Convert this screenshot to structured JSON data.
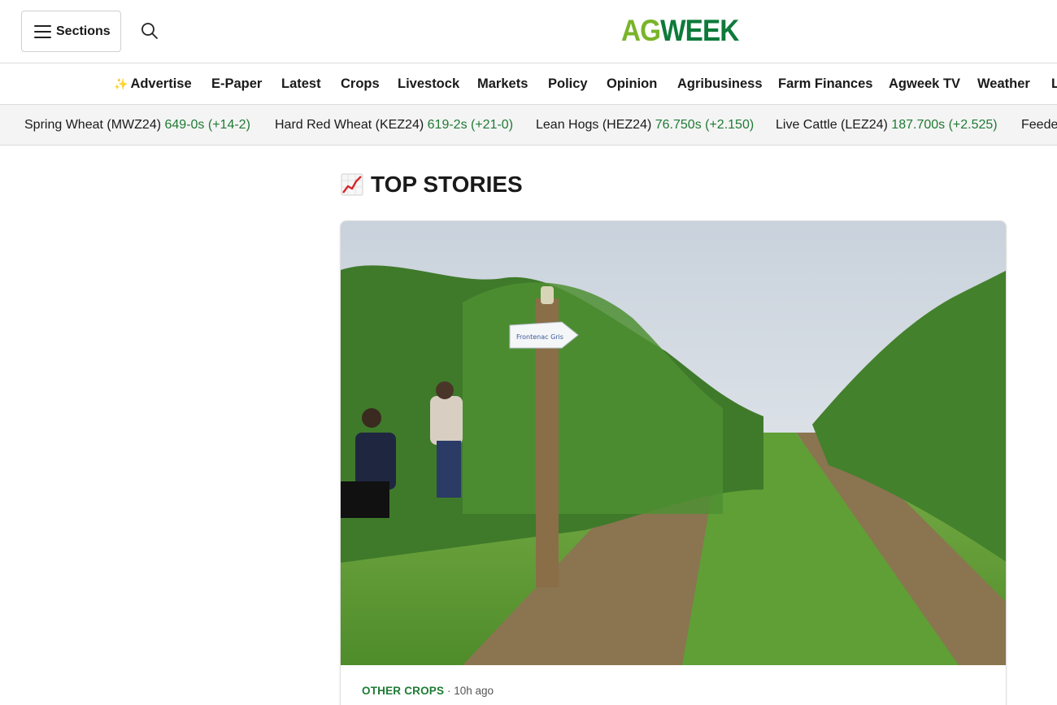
{
  "header": {
    "sections_label": "Sections",
    "logo_ag": "AG",
    "logo_week": "WEEK"
  },
  "nav": {
    "items": [
      {
        "label": "Advertise",
        "sparkle": "✨"
      },
      {
        "label": "E-Paper"
      },
      {
        "label": "Latest"
      },
      {
        "label": "Crops"
      },
      {
        "label": "Livestock"
      },
      {
        "label": "Markets"
      },
      {
        "label": "Policy"
      },
      {
        "label": "Opinion"
      },
      {
        "label": "Agribusiness"
      },
      {
        "label": "Farm Finances"
      },
      {
        "label": "Agweek TV"
      },
      {
        "label": "Weather"
      },
      {
        "label": "L"
      }
    ]
  },
  "ticker": {
    "items": [
      {
        "name": "Spring Wheat (MWZ24)",
        "value": "649-0s (+14-2)"
      },
      {
        "name": "Hard Red Wheat (KEZ24)",
        "value": "619-2s (+21-0)"
      },
      {
        "name": "Lean Hogs (HEZ24)",
        "value": "76.750s (+2.150)"
      },
      {
        "name": "Live Cattle (LEZ24)",
        "value": "187.700s (+2.525)"
      },
      {
        "name": "Feede",
        "value": ""
      }
    ]
  },
  "main": {
    "section_title": "TOP STORIES",
    "story": {
      "category": "OTHER CROPS",
      "separator": " · ",
      "time": "10h ago",
      "sign_text": "Frontenac Gris"
    }
  },
  "colors": {
    "brand_green": "#0e7a3a",
    "brand_lime": "#7ab42a",
    "ticker_value": "#1e7b34"
  }
}
